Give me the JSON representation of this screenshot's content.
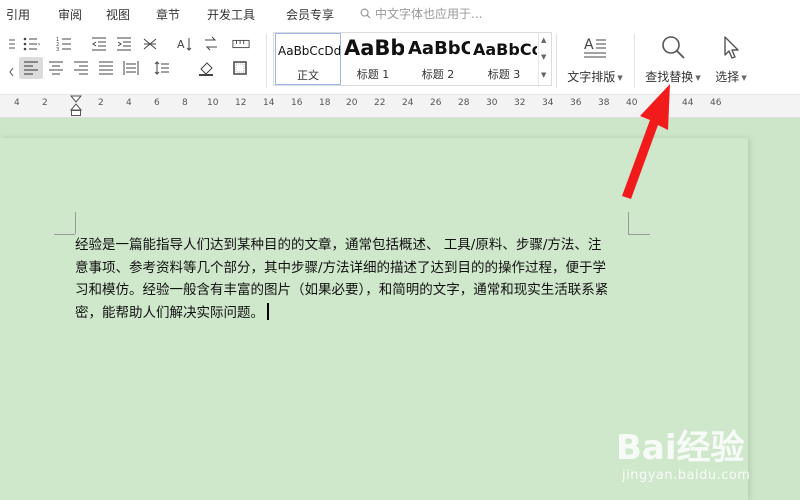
{
  "menu": {
    "items": [
      "引用",
      "审阅",
      "视图",
      "章节",
      "开发工具",
      "会员专享"
    ],
    "search_placeholder": "中文字体也应用于..."
  },
  "styles": {
    "samples": [
      "AaBbCcDd",
      "AaBb",
      "AaBbC",
      "AaBbCc"
    ],
    "labels": [
      "正文",
      "标题 1",
      "标题 2",
      "标题 3"
    ]
  },
  "toolbar": {
    "text_layout": "文字排版",
    "find_replace": "查找替换",
    "select": "选择"
  },
  "ruler": {
    "ticks": [
      "4",
      "2",
      "2",
      "4",
      "6",
      "8",
      "10",
      "12",
      "14",
      "16",
      "18",
      "20",
      "22",
      "24",
      "26",
      "28",
      "30",
      "32",
      "34",
      "36",
      "38",
      "40",
      "44",
      "46"
    ]
  },
  "document": {
    "lines": [
      "经验是一篇能指导人们达到某种目的的文章，通常包括概述、 工具/原料、步骤/方法、注",
      "意事项、参考资料等几个部分，其中步骤/方法详细的描述了达到目的的操作过程，便于学",
      "习和模仿。经验一般含有丰富的图片（如果必要），和简明的文字，通常和现实生活联系紧",
      "密，能帮助人们解决实际问题。"
    ]
  },
  "watermark": {
    "brand": "Bai经验",
    "url": "jingyan.baidu.com"
  },
  "colors": {
    "page_bg": "#cfe8cb",
    "arrow": "#f21b1b",
    "toolbar_bg": "#ffffff"
  }
}
